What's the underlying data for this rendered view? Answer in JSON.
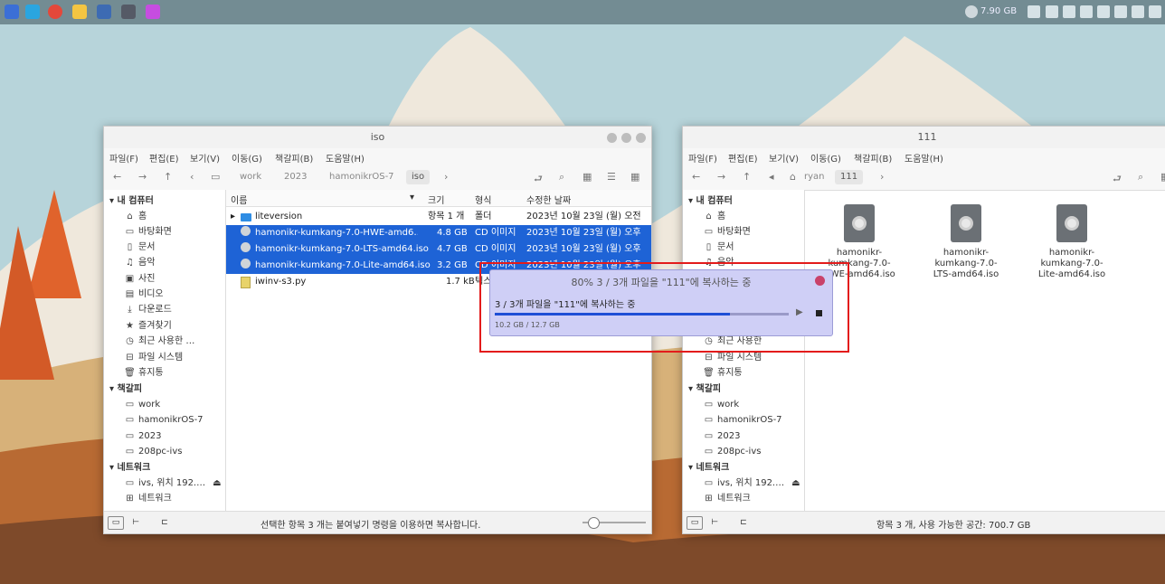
{
  "taskbar": {
    "memory": "7.90 GB",
    "apps": [
      {
        "icon": "launcher-icon",
        "color": "#3b6fd6"
      },
      {
        "icon": "browser-icon",
        "color": "#2aa5e0"
      },
      {
        "icon": "chrome-icon",
        "color": "#e4483a"
      },
      {
        "icon": "file-manager-icon",
        "color": "#f4c542"
      },
      {
        "icon": "system-monitor-icon",
        "color": "#3d6bb3"
      },
      {
        "icon": "settings-icon",
        "color": "#555a66"
      },
      {
        "icon": "drawing-app-icon",
        "color": "#c64de0"
      }
    ]
  },
  "left_window": {
    "title": "iso",
    "menu": [
      "파일(F)",
      "편집(E)",
      "보기(V)",
      "이동(G)",
      "책갈피(B)",
      "도움말(H)"
    ],
    "breadcrumb": [
      "work",
      "2023",
      "hamonikrOS-7",
      "iso"
    ],
    "columns": {
      "name": "이름",
      "size": "크기",
      "type": "형식",
      "modified": "수정한 날짜"
    },
    "files": [
      {
        "name": "liteversion",
        "size": "항목 1 개",
        "type": "폴더",
        "modified": "2023년 10월 23일 (월) 오전",
        "selected": false,
        "kind": "folder"
      },
      {
        "name": "hamonikr-kumkang-7.0-HWE-amd6…",
        "size": "4.8 GB",
        "type": "CD 이미지",
        "modified": "2023년 10월 23일 (월) 오후",
        "selected": true,
        "kind": "disc"
      },
      {
        "name": "hamonikr-kumkang-7.0-LTS-amd64.iso",
        "size": "4.7 GB",
        "type": "CD 이미지",
        "modified": "2023년 10월 23일 (월) 오후",
        "selected": true,
        "kind": "disc"
      },
      {
        "name": "hamonikr-kumkang-7.0-Lite-amd64.iso",
        "size": "3.2 GB",
        "type": "CD 이미지",
        "modified": "2023년 10월 23일 (월) 오후",
        "selected": true,
        "kind": "disc"
      },
      {
        "name": "iwinv-s3.py",
        "size": "1.7 kB",
        "type": "텍스",
        "modified": "",
        "selected": false,
        "kind": "script"
      }
    ],
    "status": "선택한 항목 3 개는 붙여넣기 명령을 이용하면 복사합니다."
  },
  "right_window": {
    "title": "111",
    "menu": [
      "파일(F)",
      "편집(E)",
      "보기(V)",
      "이동(G)",
      "책갈피(B)",
      "도움말(H)"
    ],
    "breadcrumb": [
      "ryan",
      "111"
    ],
    "files": [
      {
        "name": "hamonikr-kumkang-7.0-HWE-amd64.iso"
      },
      {
        "name": "hamonikr-kumkang-7.0-LTS-amd64.iso"
      },
      {
        "name": "hamonikr-kumkang-7.0-Lite-amd64.iso"
      }
    ],
    "file_labels": [
      [
        "hamonikr-",
        "kumkang-7.0-",
        "HWE-amd64.iso"
      ],
      [
        "hamonikr-",
        "kumkang-7.0-",
        "LTS-amd64.iso"
      ],
      [
        "hamonikr-",
        "kumkang-7.0-",
        "Lite-amd64.iso"
      ]
    ],
    "status": "항목 3 개, 사용 가능한 공간: 700.7 GB"
  },
  "sidebar": {
    "computer_header": "내 컴퓨터",
    "computer_items": [
      {
        "label": "홈",
        "icon": "home-icon"
      },
      {
        "label": "바탕화면",
        "icon": "desktop-icon"
      },
      {
        "label": "문서",
        "icon": "document-icon"
      },
      {
        "label": "음악",
        "icon": "music-icon"
      },
      {
        "label": "사진",
        "icon": "picture-icon"
      },
      {
        "label": "비디오",
        "icon": "video-icon"
      },
      {
        "label": "다운로드",
        "icon": "download-icon"
      },
      {
        "label": "즐겨찾기",
        "icon": "star-icon"
      },
      {
        "label": "최근 사용한 …",
        "icon": "clock-icon"
      },
      {
        "label": "파일 시스템",
        "icon": "drive-icon"
      },
      {
        "label": "휴지통",
        "icon": "trash-icon"
      }
    ],
    "bookmarks_header": "책갈피",
    "bookmark_items": [
      "work",
      "hamonikrOS-7",
      "2023",
      "208pc-ivs"
    ],
    "network_header": "네트워크",
    "network_items": [
      {
        "label": "ivs, 위치 192.…",
        "icon": "network-drive-icon"
      },
      {
        "label": "네트워크",
        "icon": "network-icon"
      }
    ],
    "right_visible_items": [
      {
        "label": "홈",
        "icon": "home-icon"
      },
      {
        "label": "바탕화면",
        "icon": "desktop-icon"
      },
      {
        "label": "문서",
        "icon": "document-icon"
      },
      {
        "label": "음악",
        "icon": "music-icon"
      }
    ],
    "right_lower_items": [
      {
        "label": "최근 사용한",
        "icon": "clock-icon"
      },
      {
        "label": "파일 시스템",
        "icon": "drive-icon"
      },
      {
        "label": "휴지통",
        "icon": "trash-icon"
      }
    ]
  },
  "copy_dialog": {
    "title": "80% 3 / 3개 파일을 \"111\"에 복사하는 중",
    "detail": "3 / 3개 파일을 \"111\"에 복사하는 중",
    "progress_percent": 80,
    "transfer": "10.2 GB / 12.7 GB",
    "accent": "#1e4fd6"
  },
  "colors": {
    "selection": "#1e63d6",
    "highlight_box": "#e31b1b",
    "dialog_bg": "#cfcff6"
  }
}
